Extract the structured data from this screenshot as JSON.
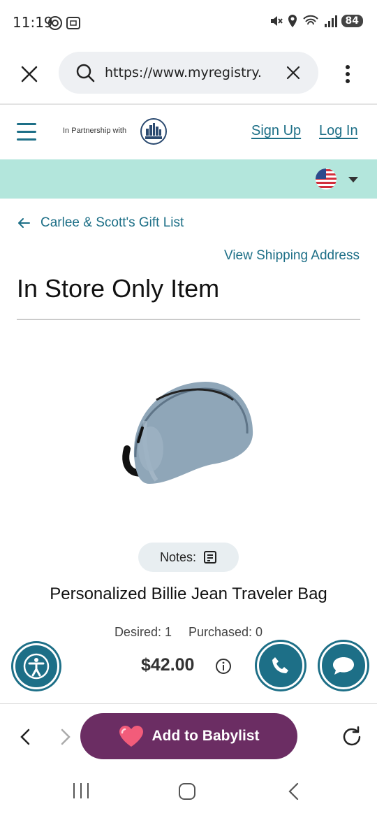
{
  "status_bar": {
    "time": "11:19",
    "battery": "84",
    "network": "6"
  },
  "browser": {
    "url": "https://www.myregistry.",
    "icons": [
      "close-icon",
      "search-icon",
      "clear-icon",
      "more-vert-icon"
    ]
  },
  "header": {
    "partner_text": "In Partnership with",
    "signup": "Sign Up",
    "login": "Log In"
  },
  "registry": {
    "back_label": "Carlee & Scott's Gift List",
    "shipping_link": "View Shipping Address",
    "page_title": "In Store Only Item"
  },
  "product": {
    "notes_label": "Notes:",
    "name": "Personalized Billie Jean Traveler Bag",
    "desired": "Desired: 1",
    "purchased": "Purchased: 0",
    "price": "$42.00"
  },
  "bottom_bar": {
    "add_button": "Add to Babylist"
  },
  "colors": {
    "brand_teal": "#1d6f87",
    "band_mint": "#b3e6dc",
    "babylist_purple": "#6b2d63",
    "heart_pink": "#f25c7a"
  }
}
